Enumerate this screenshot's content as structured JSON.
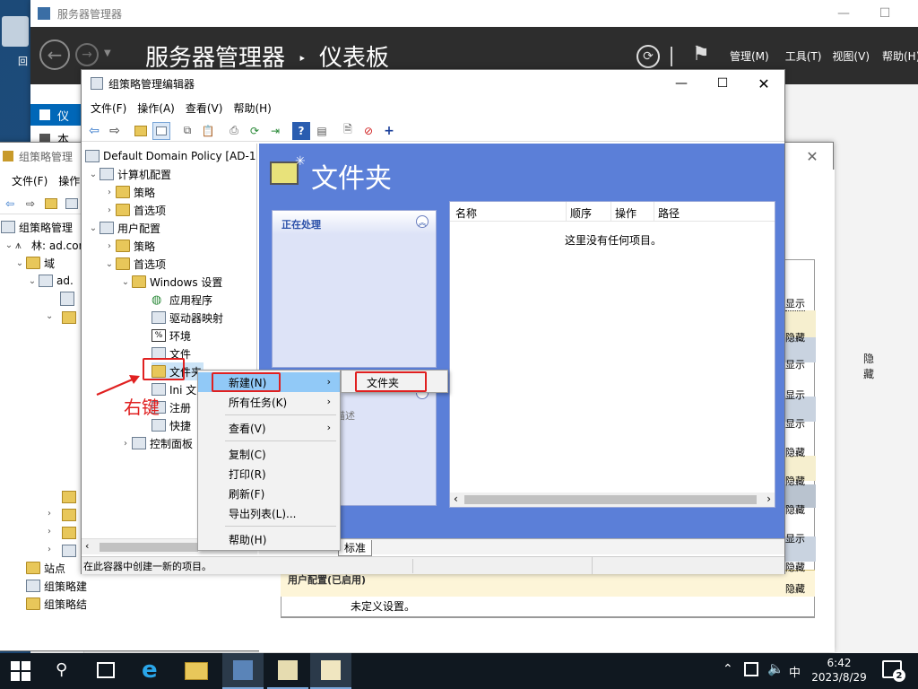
{
  "desktop": {
    "partial_label": "回"
  },
  "server_manager": {
    "window_title": "服务器管理器",
    "breadcrumb_app": "服务器管理器",
    "breadcrumb_sep": "‣",
    "breadcrumb_page": "仪表板",
    "menu": [
      "管理(M)",
      "工具(T)",
      "视图(V)",
      "帮助(H)"
    ],
    "side_selected": "仪",
    "side_item2": "本"
  },
  "gpm": {
    "window_title": "组策略管理",
    "menu": [
      "文件(F)",
      "操作"
    ],
    "tree": [
      "组策略管理",
      "林: ad.com",
      "域",
      "ad.",
      "站点",
      "组策略建",
      "组策略结"
    ],
    "right_labels": [
      "显示",
      "隐藏",
      "显示",
      "隐藏",
      "显示",
      "隐藏",
      "显示",
      "隐藏",
      "显示",
      "隐藏",
      "显示",
      "隐藏"
    ],
    "hide_label": "隐藏",
    "user_config_label": "用户配置(已启用)",
    "undefined_label": "未定义设置。"
  },
  "gpme": {
    "window_title": "组策略管理编辑器",
    "menu": [
      "文件(F)",
      "操作(A)",
      "查看(V)",
      "帮助(H)"
    ],
    "tree": {
      "root": "Default Domain Policy [AD-1.",
      "computer_config": "计算机配置",
      "policies": "策略",
      "preferences": "首选项",
      "user_config": "用户配置",
      "policies2": "策略",
      "preferences2": "首选项",
      "windows_settings": "Windows 设置",
      "applications": "应用程序",
      "drive_maps": "驱动器映射",
      "environment": "环境",
      "files": "文件",
      "folders": "文件夹",
      "ini_files": "Ini 文",
      "registry": "注册",
      "shortcuts": "快捷",
      "control_panel": "控制面板"
    },
    "header_title": "文件夹",
    "processing_label": "正在处理",
    "desc_label": "描述",
    "columns": [
      "名称",
      "顺序",
      "操作",
      "路径"
    ],
    "empty_text": "这里没有任何项目。",
    "tab_label": "标准",
    "status": "在此容器中创建一新的项目。"
  },
  "context_menu": {
    "items": [
      "新建(N)",
      "所有任务(K)",
      "查看(V)",
      "复制(C)",
      "打印(R)",
      "刷新(F)",
      "导出列表(L)...",
      "帮助(H)"
    ]
  },
  "submenu": {
    "item": "文件夹"
  },
  "annotation": {
    "text": "右键",
    "color": "#e02020"
  },
  "taskbar": {
    "time": "6:42",
    "date": "2023/8/29",
    "ime": "中",
    "notify_count": "2"
  },
  "colors": {
    "accent": "#0067b8",
    "header_blue": "#5b7fd8",
    "panel_blue": "#dde3f7"
  }
}
